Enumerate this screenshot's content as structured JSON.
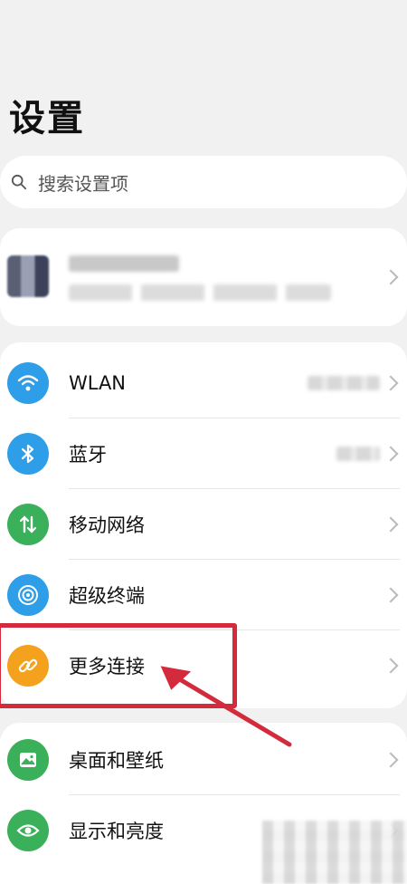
{
  "page": {
    "title": "设置"
  },
  "search": {
    "placeholder": "搜索设置项"
  },
  "settings": [
    {
      "label": "WLAN",
      "icon": "wifi-icon",
      "color": "#2f9ee8"
    },
    {
      "label": "蓝牙",
      "icon": "bluetooth-icon",
      "color": "#2f9ee8"
    },
    {
      "label": "移动网络",
      "icon": "mobile-data-icon",
      "color": "#3bb05a"
    },
    {
      "label": "超级终端",
      "icon": "super-device-icon",
      "color": "#2f9ee8"
    },
    {
      "label": "更多连接",
      "icon": "link-icon",
      "color": "#f4a11d"
    },
    {
      "label": "桌面和壁纸",
      "icon": "wallpaper-icon",
      "color": "#3bb05a"
    },
    {
      "label": "显示和亮度",
      "icon": "eye-icon",
      "color": "#3bb05a"
    }
  ],
  "annotation": {
    "highlight_color": "#d42b3c"
  }
}
